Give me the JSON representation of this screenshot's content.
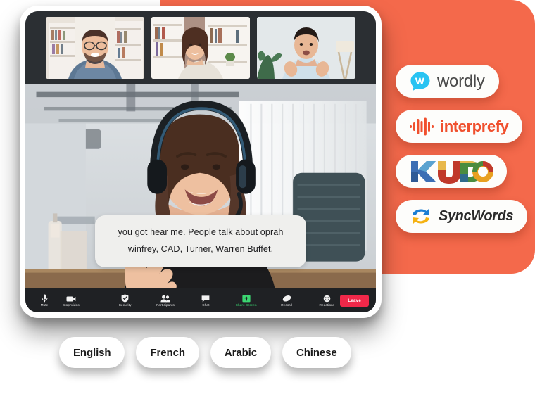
{
  "theme": {
    "orange_panel": "#F4694B",
    "toolbar_bg": "#1F2124",
    "leave_red": "#F02849",
    "share_green": "#3BD671",
    "caption_bg": "#EFEFED"
  },
  "meeting": {
    "thumbnails": [
      {
        "name": "participant-1",
        "alt": "Smiling man with glasses in front of bookshelf"
      },
      {
        "name": "participant-2",
        "alt": "Smiling woman with curly hair in front of bookshelf"
      },
      {
        "name": "participant-3",
        "alt": "Man in light blue shirt gesturing with hands"
      }
    ],
    "active_speaker": {
      "name": "active-speaker",
      "alt": "Woman wearing headphones waving at camera in an office"
    },
    "caption": {
      "line1": "you got hear me. People talk about oprah",
      "line2": "winfrey, CAD, Turner, Warren Buffet."
    },
    "toolbar": {
      "items": [
        {
          "id": "mute",
          "label": "Mute",
          "icon": "microphone-icon",
          "active": false
        },
        {
          "id": "stop-video",
          "label": "Stop Video",
          "icon": "video-camera-icon",
          "active": false
        },
        {
          "id": "security",
          "label": "Security",
          "icon": "shield-check-icon",
          "active": false
        },
        {
          "id": "participants",
          "label": "Participants",
          "icon": "people-icon",
          "active": false
        },
        {
          "id": "chat",
          "label": "Chat",
          "icon": "chat-bubble-icon",
          "active": false
        },
        {
          "id": "share-screen",
          "label": "Share Screen",
          "icon": "share-screen-icon",
          "active": true
        },
        {
          "id": "record",
          "label": "Record",
          "icon": "record-icon",
          "active": false
        },
        {
          "id": "reactions",
          "label": "Reactions",
          "icon": "reactions-icon",
          "active": false
        }
      ],
      "leave_label": "Leave"
    }
  },
  "partners": [
    {
      "id": "wordly",
      "name": "wordly",
      "mark": "wordly-speech-bubble-icon"
    },
    {
      "id": "interprefy",
      "name": "interprefy",
      "mark": "interprefy-waveform-icon"
    },
    {
      "id": "kudo",
      "name": "KUDO",
      "mark": "kudo-wordmark-icon"
    },
    {
      "id": "syncwords",
      "name": "SyncWords",
      "mark": "syncwords-sync-arrows-icon"
    }
  ],
  "languages": [
    {
      "id": "english",
      "label": "English"
    },
    {
      "id": "french",
      "label": "French"
    },
    {
      "id": "arabic",
      "label": "Arabic"
    },
    {
      "id": "chinese",
      "label": "Chinese"
    }
  ]
}
